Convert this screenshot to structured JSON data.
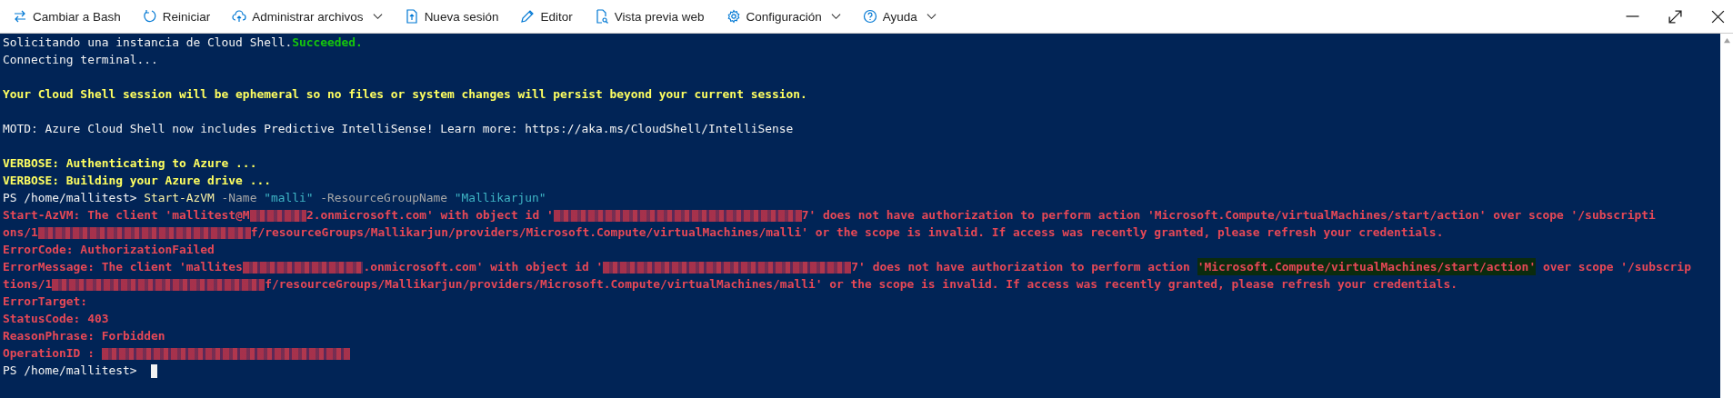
{
  "toolbar": {
    "items": [
      {
        "label": "Cambiar a Bash",
        "kind": "switch",
        "has_menu": false
      },
      {
        "label": "Reiniciar",
        "kind": "restart",
        "has_menu": false
      },
      {
        "label": "Administrar archivos",
        "kind": "cloud",
        "has_menu": true
      },
      {
        "label": "Nueva sesión",
        "kind": "session",
        "has_menu": false
      },
      {
        "label": "Editor",
        "kind": "pencil",
        "has_menu": false
      },
      {
        "label": "Vista previa web",
        "kind": "preview",
        "has_menu": false
      },
      {
        "label": "Configuración",
        "kind": "gear",
        "has_menu": true
      },
      {
        "label": "Ayuda",
        "kind": "help",
        "has_menu": true
      }
    ],
    "window_controls": [
      {
        "kind": "minimize"
      },
      {
        "kind": "maximize"
      },
      {
        "kind": "close"
      }
    ]
  },
  "terminal": {
    "lines": [
      {
        "kind": "text",
        "segments": [
          {
            "kind": "plain",
            "text": "Solicitando una instancia de Cloud Shell."
          },
          {
            "kind": "success",
            "text": "Succeeded."
          }
        ]
      },
      {
        "kind": "text",
        "segments": [
          {
            "kind": "plain",
            "text": "Connecting terminal..."
          }
        ]
      },
      {
        "kind": "blank"
      },
      {
        "kind": "text",
        "segments": [
          {
            "kind": "warning",
            "text": "Your Cloud Shell session will be ephemeral so no files or system changes will persist beyond your current session."
          }
        ]
      },
      {
        "kind": "blank"
      },
      {
        "kind": "text",
        "segments": [
          {
            "kind": "plain",
            "text": "MOTD: Azure Cloud Shell now includes Predictive IntelliSense! Learn more: https://aka.ms/CloudShell/IntelliSense"
          }
        ]
      },
      {
        "kind": "blank"
      },
      {
        "kind": "text",
        "segments": [
          {
            "kind": "warning",
            "text": "VERBOSE: Authenticating to Azure ..."
          }
        ]
      },
      {
        "kind": "text",
        "segments": [
          {
            "kind": "warning",
            "text": "VERBOSE: Building your Azure drive ..."
          }
        ]
      },
      {
        "kind": "text",
        "segments": [
          {
            "kind": "plain",
            "text": "PS /home/mallitest> "
          },
          {
            "kind": "command",
            "text": "Start-AzVM"
          },
          {
            "kind": "param",
            "text": " -Name "
          },
          {
            "kind": "string",
            "text": "\"malli\""
          },
          {
            "kind": "param",
            "text": " -ResourceGroupName "
          },
          {
            "kind": "string",
            "text": "\"Mallikarjun\""
          }
        ]
      },
      {
        "kind": "text",
        "segments": [
          {
            "kind": "error",
            "text": "Start-AzVM: The client 'mallitest@M"
          },
          {
            "kind": "redactshort"
          },
          {
            "kind": "error",
            "text": "2.onmicrosoft.com' with object id '"
          },
          {
            "kind": "redactguid"
          },
          {
            "kind": "error",
            "text": "7' does not have authorization to perform action 'Microsoft.Compute/virtualMachines/start/action' over scope '/subscripti"
          }
        ]
      },
      {
        "kind": "text",
        "segments": [
          {
            "kind": "error",
            "text": "ons/1"
          },
          {
            "kind": "redactlong"
          },
          {
            "kind": "error",
            "text": "f/resourceGroups/Mallikarjun/providers/Microsoft.Compute/virtualMachines/malli' or the scope is invalid. If access was recently granted, please refresh your credentials."
          }
        ]
      },
      {
        "kind": "text",
        "segments": [
          {
            "kind": "error",
            "text": "ErrorCode: AuthorizationFailed"
          }
        ]
      },
      {
        "kind": "text",
        "segments": [
          {
            "kind": "error",
            "text": "ErrorMessage: The client 'mallites"
          },
          {
            "kind": "redactmedium"
          },
          {
            "kind": "error",
            "text": ".onmicrosoft.com' with object id '"
          },
          {
            "kind": "redactguid"
          },
          {
            "kind": "error",
            "text": "7' does not have authorization to perform action "
          },
          {
            "kind": "highlight",
            "text": "'Microsoft.Compute/virtualMachines/start/action'"
          },
          {
            "kind": "error",
            "text": " over scope '/subscrip"
          }
        ]
      },
      {
        "kind": "text",
        "segments": [
          {
            "kind": "error",
            "text": "tions/1"
          },
          {
            "kind": "redactlong"
          },
          {
            "kind": "error",
            "text": "f/resourceGroups/Mallikarjun/providers/Microsoft.Compute/virtualMachines/malli' or the scope is invalid. If access was recently granted, please refresh your credentials."
          }
        ]
      },
      {
        "kind": "text",
        "segments": [
          {
            "kind": "error",
            "text": "ErrorTarget:"
          }
        ]
      },
      {
        "kind": "text",
        "segments": [
          {
            "kind": "error",
            "text": "StatusCode: 403"
          }
        ]
      },
      {
        "kind": "text",
        "segments": [
          {
            "kind": "error",
            "text": "ReasonPhrase: Forbidden"
          }
        ]
      },
      {
        "kind": "text",
        "segments": [
          {
            "kind": "error",
            "text": "OperationID : "
          },
          {
            "kind": "redactguid"
          }
        ]
      },
      {
        "kind": "prompt",
        "segments": [
          {
            "kind": "plain",
            "text": "PS /home/mallitest> "
          }
        ]
      }
    ]
  }
}
